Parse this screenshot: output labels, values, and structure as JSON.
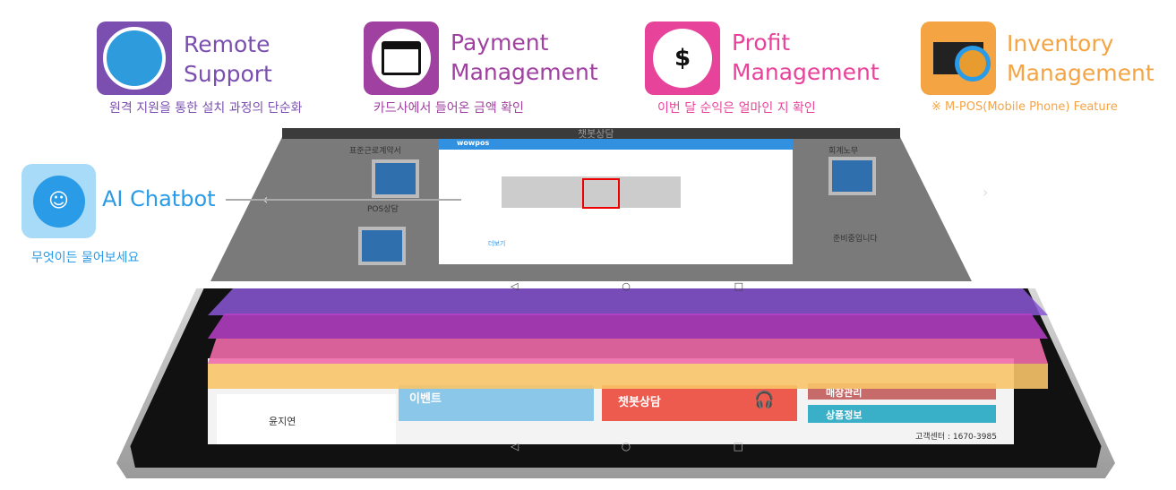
{
  "features": [
    {
      "id": "remote",
      "title": "Remote\nSupport",
      "subtitle": "원격 지원을 통한 설치 과정의 단순화",
      "icon": "remote-desktop-icon",
      "color": "#7a4fb0",
      "title_color": "#7a4fb0",
      "sub_color": "#7a4fb0"
    },
    {
      "id": "payment",
      "title": "Payment\nManagement",
      "subtitle": "카드사에서 들어온 금액 확인",
      "icon": "credit-card-icon",
      "color": "#a040a0",
      "title_color": "#a040a0",
      "sub_color": "#a040a0"
    },
    {
      "id": "profit",
      "title": "Profit\nManagement",
      "subtitle": "이번 달 순익은 얼마인 지 확인",
      "icon": "profit-chart-icon",
      "color": "#e8439a",
      "title_color": "#e8439a",
      "sub_color": "#e8439a"
    },
    {
      "id": "inventory",
      "title": "Inventory\nManagement",
      "subtitle": "※ M-POS(Mobile Phone) Feature",
      "icon": "inventory-search-icon",
      "color": "#f5a443",
      "title_color": "#f5a443",
      "sub_color": "#f5a443"
    }
  ],
  "chatbot": {
    "title": "AI Chatbot",
    "subtitle": "무엇이든 물어보세요",
    "icon": "chatbot-face-icon",
    "color": "#2a9be6"
  },
  "screen_top": {
    "header": "챗봇상담",
    "left_top_label": "표준근로계약서",
    "left_bottom_label": "POS상담",
    "right_top_label": "회계노무",
    "right_bottom_label": "준비중입니다",
    "chat_name": "wowpos",
    "chat_footer": "더보기"
  },
  "screen_bottom": {
    "tile_event": "이벤트",
    "tile_chatbot": "챗봇상담",
    "tile_sales": "매장관리",
    "tile_product": "상품정보",
    "customer_center": "고객센터 : 1670-3985",
    "user_name": "윤지연"
  },
  "colors": {
    "layer_purple": "#8a57d6",
    "layer_magenta": "#b83fc9",
    "layer_pink": "#f06aa8",
    "layer_orange": "#f7b24a",
    "layer_yellow": "#f8d57e"
  }
}
